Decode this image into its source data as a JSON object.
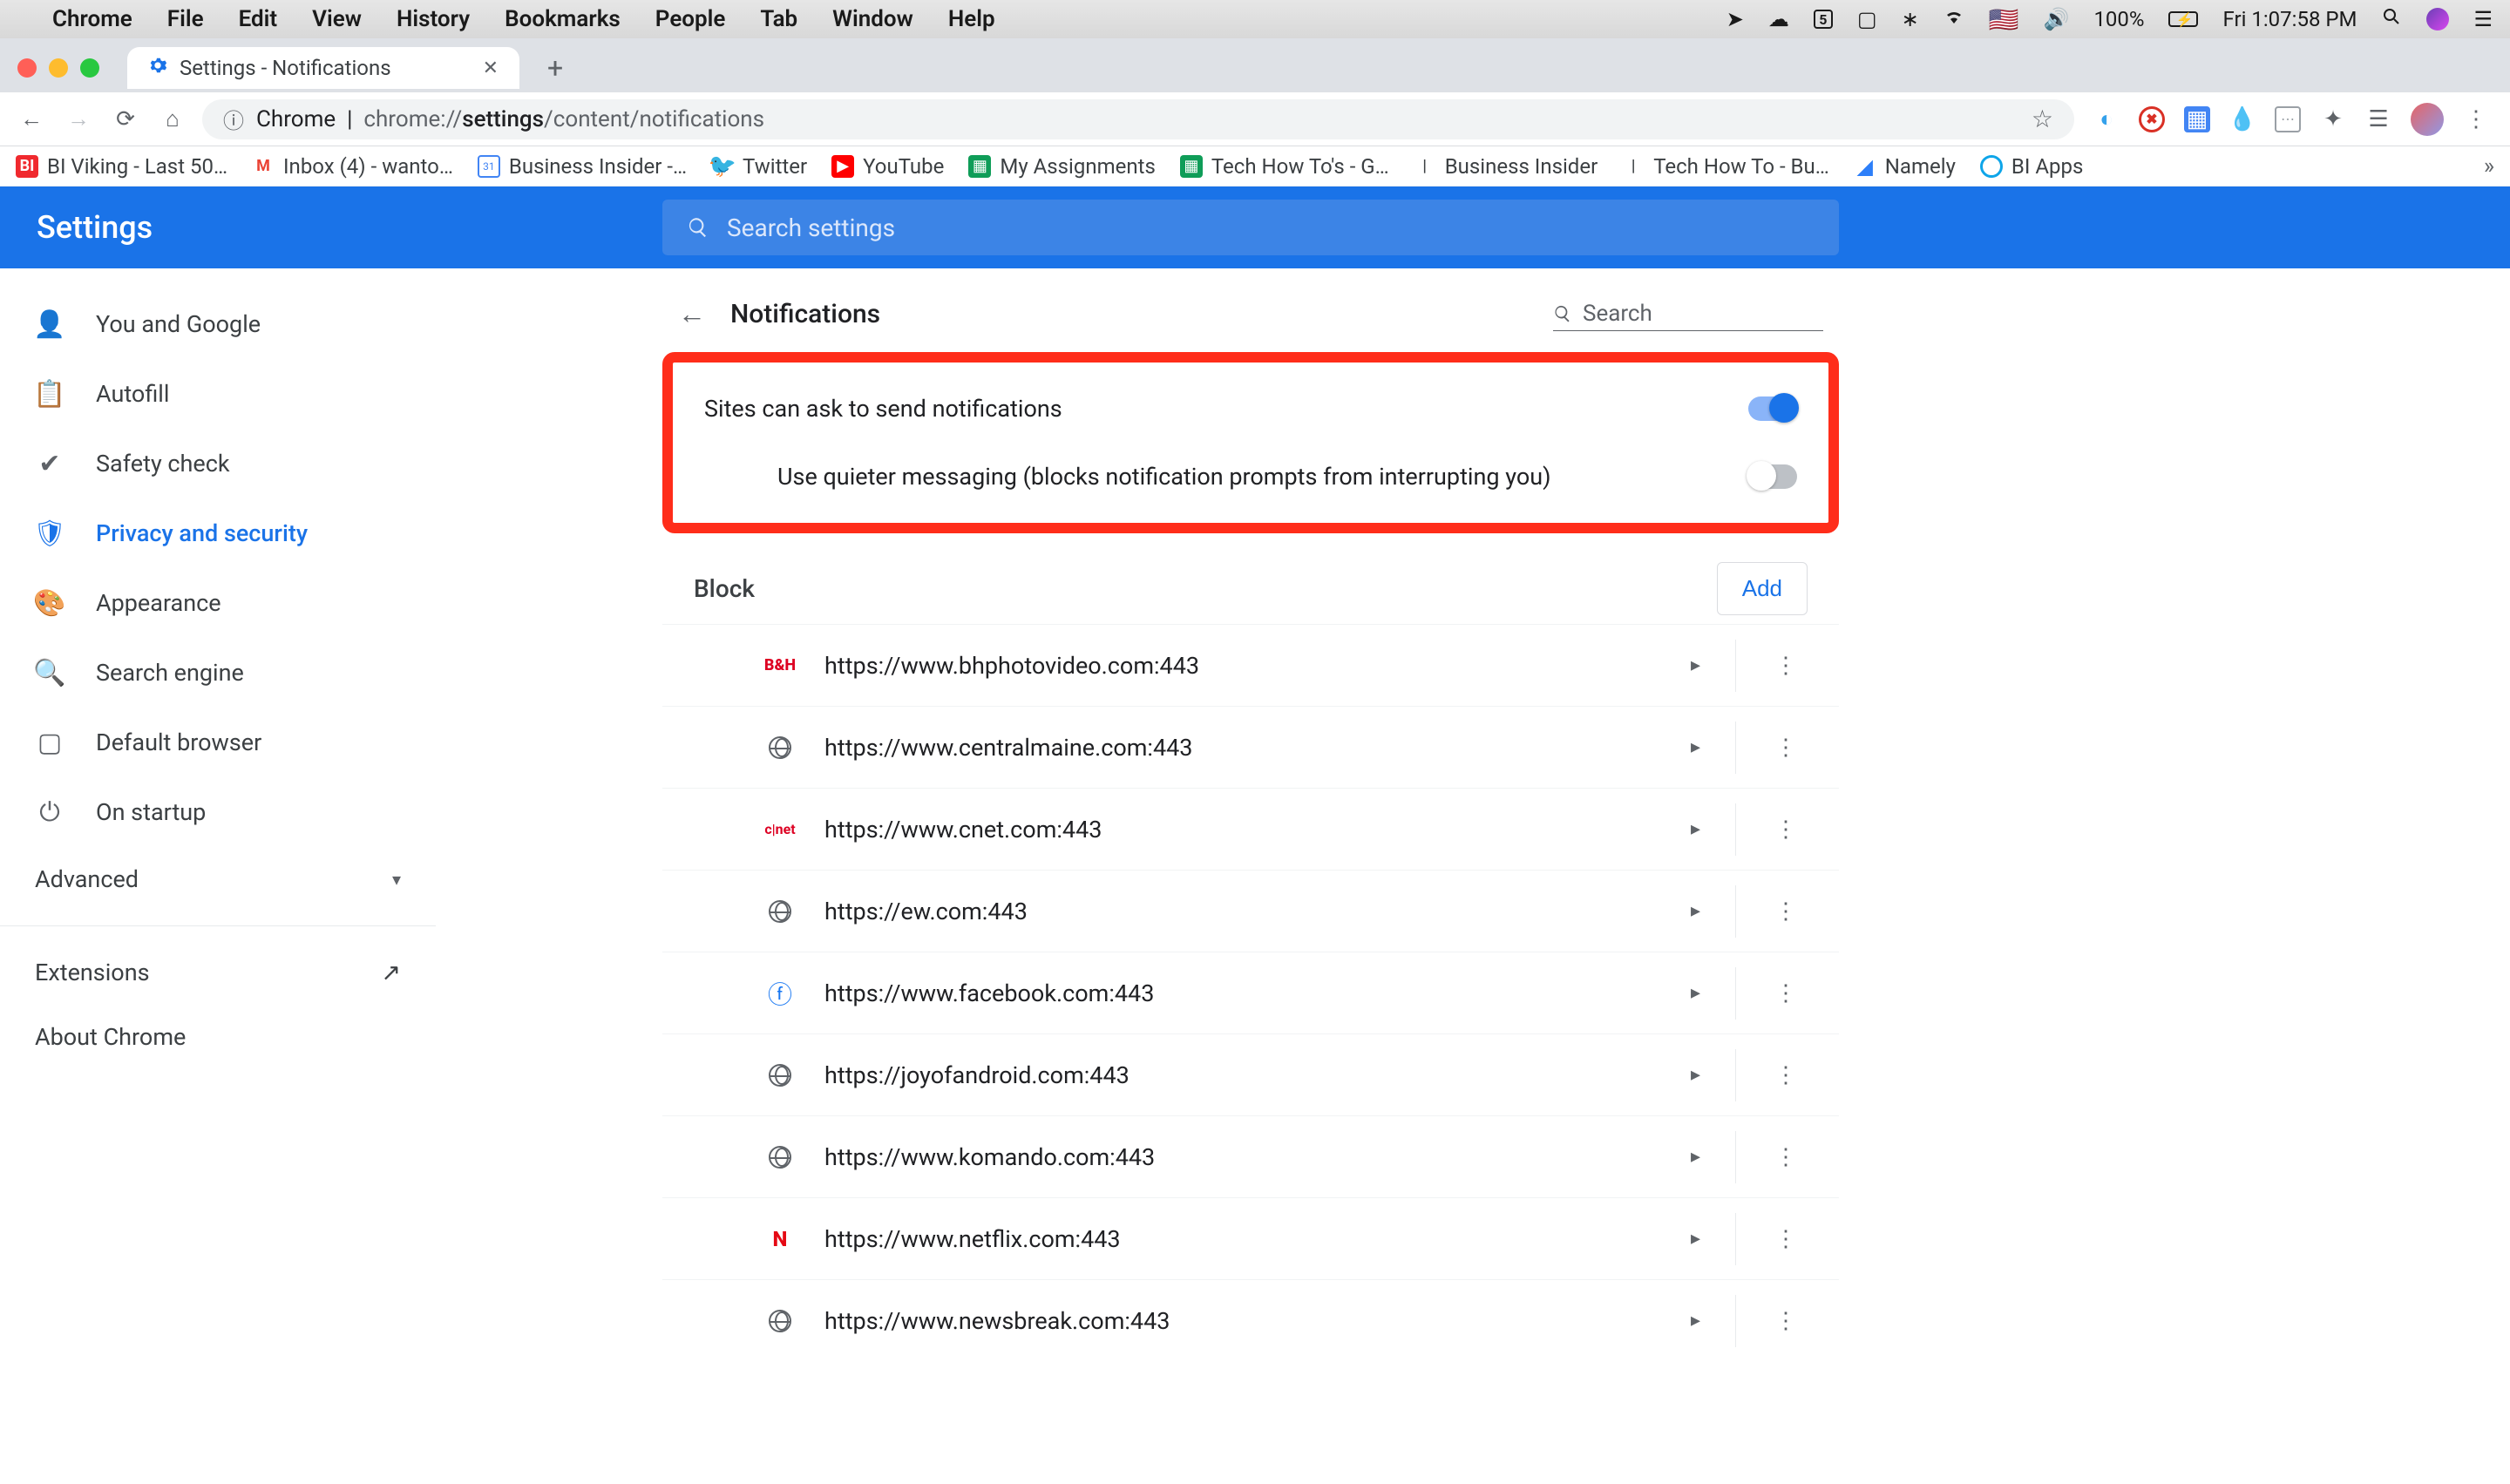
{
  "mac_menu": {
    "app": "Chrome",
    "items": [
      "File",
      "Edit",
      "View",
      "History",
      "Bookmarks",
      "People",
      "Tab",
      "Window",
      "Help"
    ],
    "battery": "100%",
    "clock": "Fri 1:07:58 PM"
  },
  "tab": {
    "title": "Settings - Notifications"
  },
  "omnibox": {
    "prefix": "Chrome",
    "url_pre": "chrome://",
    "url_bold": "settings",
    "url_post": "/content/notifications"
  },
  "bookmarks": [
    {
      "label": "BI Viking - Last 50…",
      "color": "#f0292e",
      "initial": "BI"
    },
    {
      "label": "Inbox (4) - wanto…",
      "type": "gmail"
    },
    {
      "label": "Business Insider -…",
      "type": "gcal"
    },
    {
      "label": "Twitter",
      "type": "twitter"
    },
    {
      "label": "YouTube",
      "type": "youtube"
    },
    {
      "label": "My Assignments",
      "type": "gsheet"
    },
    {
      "label": "Tech How To's - G…",
      "type": "gsheet"
    },
    {
      "label": "Business Insider",
      "type": "bar"
    },
    {
      "label": "Tech How To - Bu…",
      "type": "bar"
    },
    {
      "label": "Namely",
      "type": "namely"
    },
    {
      "label": "BI Apps",
      "type": "biapps"
    }
  ],
  "settings_header": {
    "title": "Settings",
    "search_placeholder": "Search settings"
  },
  "sidebar": {
    "items": [
      {
        "label": "You and Google"
      },
      {
        "label": "Autofill"
      },
      {
        "label": "Safety check"
      },
      {
        "label": "Privacy and security",
        "active": true
      },
      {
        "label": "Appearance"
      },
      {
        "label": "Search engine"
      },
      {
        "label": "Default browser"
      },
      {
        "label": "On startup"
      }
    ],
    "advanced": "Advanced",
    "extensions": "Extensions",
    "about": "About Chrome"
  },
  "content": {
    "title": "Notifications",
    "search_placeholder": "Search",
    "toggle_ask": "Sites can ask to send notifications",
    "toggle_quiet": "Use quieter messaging (blocks notification prompts from interrupting you)",
    "block_label": "Block",
    "add_label": "Add",
    "blocked_sites": [
      {
        "url": "https://www.bhphotovideo.com:443",
        "favicon": "bh"
      },
      {
        "url": "https://www.centralmaine.com:443",
        "favicon": "globe"
      },
      {
        "url": "https://www.cnet.com:443",
        "favicon": "cnet"
      },
      {
        "url": "https://ew.com:443",
        "favicon": "globe"
      },
      {
        "url": "https://www.facebook.com:443",
        "favicon": "fb"
      },
      {
        "url": "https://joyofandroid.com:443",
        "favicon": "globe"
      },
      {
        "url": "https://www.komando.com:443",
        "favicon": "globe"
      },
      {
        "url": "https://www.netflix.com:443",
        "favicon": "netflix"
      },
      {
        "url": "https://www.newsbreak.com:443",
        "favicon": "globe"
      }
    ]
  }
}
